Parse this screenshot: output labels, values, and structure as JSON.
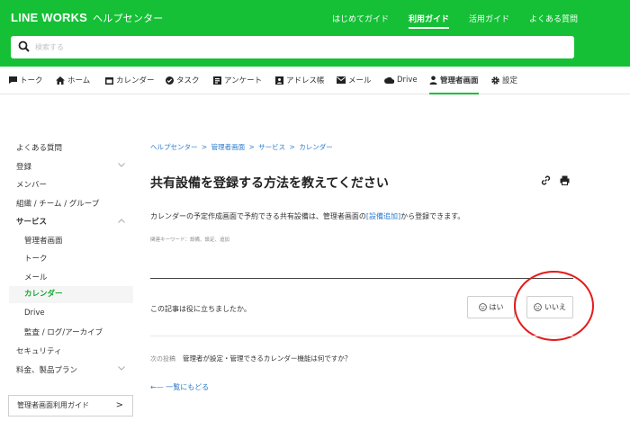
{
  "header": {
    "brand_logo": "LINE WORKS",
    "brand_sub": "ヘルプセンター",
    "nav": [
      "はじめてガイド",
      "利用ガイド",
      "活用ガイド",
      "よくある質問"
    ],
    "active_nav": "利用ガイド",
    "brand_color": "#15c036"
  },
  "search": {
    "placeholder": "検索する"
  },
  "appbar": {
    "tabs": [
      {
        "label": "トーク",
        "icon": "talk-icon"
      },
      {
        "label": "ホーム",
        "icon": "home-icon"
      },
      {
        "label": "カレンダー",
        "icon": "calendar-icon"
      },
      {
        "label": "タスク",
        "icon": "task-icon"
      },
      {
        "label": "アンケート",
        "icon": "survey-icon"
      },
      {
        "label": "アドレス帳",
        "icon": "address-book-icon"
      },
      {
        "label": "メール",
        "icon": "mail-icon"
      },
      {
        "label": "Drive",
        "icon": "cloud-icon"
      },
      {
        "label": "管理者画面",
        "icon": "admin-icon"
      },
      {
        "label": "設定",
        "icon": "gear-icon"
      }
    ],
    "active_tab": "管理者画面"
  },
  "sidebar": {
    "items": [
      "よくある質問",
      "登録",
      "メンバー",
      "組織 / チーム / グループ",
      "サービス"
    ],
    "children": [
      "管理者画面",
      "トーク",
      "メール",
      "カレンダー",
      "Drive",
      "監査 / ログ/アーカイブ"
    ],
    "after": [
      "セキュリティ",
      "料金、製品プラン"
    ],
    "selected": "カレンダー",
    "guide_button": "管理者画面利用ガイド",
    "guide_arrow": ">"
  },
  "article": {
    "breadcrumb": [
      "ヘルプセンター",
      "管理者画面",
      "サービス",
      "カレンダー"
    ],
    "breadcrumb_sep": ">",
    "title": "共有設備を登録する方法を教えてください",
    "body_before": "カレンダーの予定作成画面で予約できる共有設備は、管理者画面の",
    "body_link": "[設備追加]",
    "body_after": "から登録できます。",
    "keywords": "関連キーワード：設備、設定、追加",
    "feedback_question": "この記事は役に立ちましたか。",
    "yes_label": "はい",
    "no_label": "いいえ",
    "next_label": "次の投稿",
    "next_title": "管理者が設定・管理できるカレンダー機能は何ですか？",
    "back_label": "一覧にもどる",
    "back_arrow": "←—"
  },
  "annotation_color": "#e31b1b"
}
